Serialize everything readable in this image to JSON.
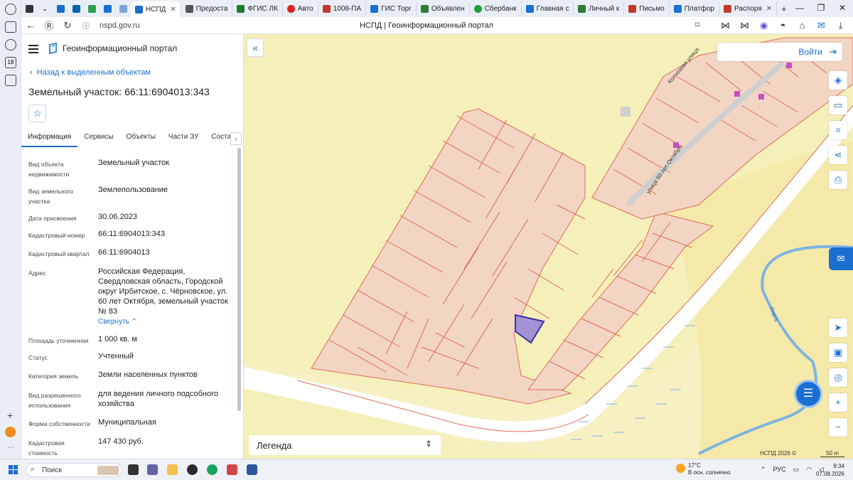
{
  "browser": {
    "tabs": [
      {
        "label": "НСПД",
        "color": "#1a6fd1",
        "active": true
      },
      {
        "label": "Предоста",
        "color": "#555"
      },
      {
        "label": "ФГИС ЛК",
        "color": "#1f7a2e"
      },
      {
        "label": "Авто",
        "color": "#e02020"
      },
      {
        "label": "1008-ПА",
        "color": "#c0392b"
      },
      {
        "label": "ГИС Торг",
        "color": "#1a6fd1"
      },
      {
        "label": "Объявлен",
        "color": "#2e7d32"
      },
      {
        "label": "Сбербанк",
        "color": "#21a038"
      },
      {
        "label": "Главная с",
        "color": "#1a6fd1"
      },
      {
        "label": "Личный к",
        "color": "#2e7d32"
      },
      {
        "label": "Письмо",
        "color": "#c0392b"
      },
      {
        "label": "Платфор",
        "color": "#1a6fd1"
      },
      {
        "label": "Распоря",
        "color": "#c0392b"
      }
    ],
    "url": "nspd.gov.ru",
    "page_title": "НСПД | Геоинформационный портал"
  },
  "panel": {
    "portal_name": "Геоинформационный портал",
    "back_link": "Назад к выделенным объектам",
    "title": "Земельный участок: 66:11:6904013:343",
    "tabs": [
      "Информация",
      "Сервисы",
      "Объекты",
      "Части ЗУ",
      "Состав"
    ],
    "properties": [
      {
        "label": "Вид объекта недвижимости",
        "value": "Земельный участок"
      },
      {
        "label": "Вид земельного участка",
        "value": "Землепользование"
      },
      {
        "label": "Дата присвоения",
        "value": "30.06.2023"
      },
      {
        "label": "Кадастровый номер",
        "value": "66:11:6904013:343"
      },
      {
        "label": "Кадастровый квартал",
        "value": "66:11:6904013"
      },
      {
        "label": "Адрес",
        "value": "Российская Федерация, Свердловская область, Городской округ Ирбитское, с. Чёрновское, ул. 60 лет Октября, земельный участок № 83"
      },
      {
        "label": "Площадь уточненная",
        "value": "1 000 кв. м"
      },
      {
        "label": "Статус",
        "value": "Учтенный"
      },
      {
        "label": "Категория земель",
        "value": "Земли населенных пунктов"
      },
      {
        "label": "Вид разрешенного использования",
        "value": "для ведения личного подсобного хозяйства"
      },
      {
        "label": "Форма собственности",
        "value": "Муниципальная"
      },
      {
        "label": "Кадастровая стоимость",
        "value": "147 430 руб."
      }
    ],
    "collapse_label": "Свернуть"
  },
  "map": {
    "login_label": "Войти",
    "legend_label": "Легенда",
    "copyright": "НСПД 2026 ©",
    "scale": "50 m",
    "street_1": "улица 60 лет Октября",
    "street_2": "Колхозная улица",
    "river": "Кирга",
    "colors": {
      "parcel_fill": "#f3d5c4",
      "parcel_line": "#e06c5a",
      "selected": "#a393d6",
      "selected_line": "#3a2fa8",
      "background": "#f5efb9",
      "river": "#7fb3e0"
    }
  },
  "taskbar": {
    "search": "Поиск",
    "temperature": "17°C",
    "weather": "В осн. солнечно",
    "lang": "РУС",
    "time": "9:34",
    "date": "07.08.2026"
  }
}
